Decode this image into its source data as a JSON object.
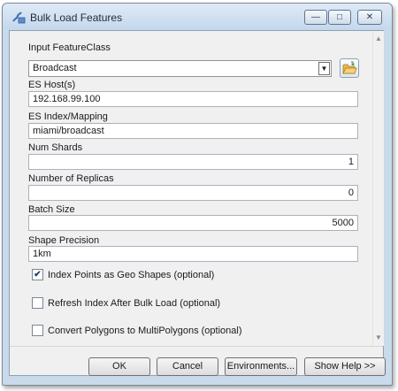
{
  "window": {
    "title": "Bulk Load Features",
    "controls": {
      "minimize": "—",
      "maximize": "□",
      "close": "✕"
    }
  },
  "form": {
    "input_featureclass": {
      "label": "Input FeatureClass",
      "value": "Broadcast"
    },
    "es_host": {
      "label": "ES Host(s)",
      "value": "192.168.99.100"
    },
    "es_index": {
      "label": "ES Index/Mapping",
      "value": "miami/broadcast"
    },
    "num_shards": {
      "label": "Num Shards",
      "value": "1"
    },
    "replicas": {
      "label": "Number of Replicas",
      "value": "0"
    },
    "batch_size": {
      "label": "Batch Size",
      "value": "5000"
    },
    "shape_precision": {
      "label": "Shape Precision",
      "value": "1km"
    },
    "checkboxes": [
      {
        "label": "Index Points as Geo Shapes (optional)",
        "checked": true,
        "mark": "✔"
      },
      {
        "label": "Refresh Index After Bulk Load (optional)",
        "checked": false,
        "mark": ""
      },
      {
        "label": "Convert Polygons to MultiPolygons (optional)",
        "checked": false,
        "mark": ""
      }
    ]
  },
  "buttons": {
    "ok": "OK",
    "cancel": "Cancel",
    "environments": "Environments...",
    "help": "Show Help >>"
  },
  "icons": {
    "app": "toolbox-script-icon",
    "browse": "open-folder-icon",
    "dropdown": "chevron-down-icon"
  },
  "colors": {
    "titlebar": "#c9daea",
    "dialog_bg": "#f0f0f0",
    "folder": "#e8b84a"
  }
}
